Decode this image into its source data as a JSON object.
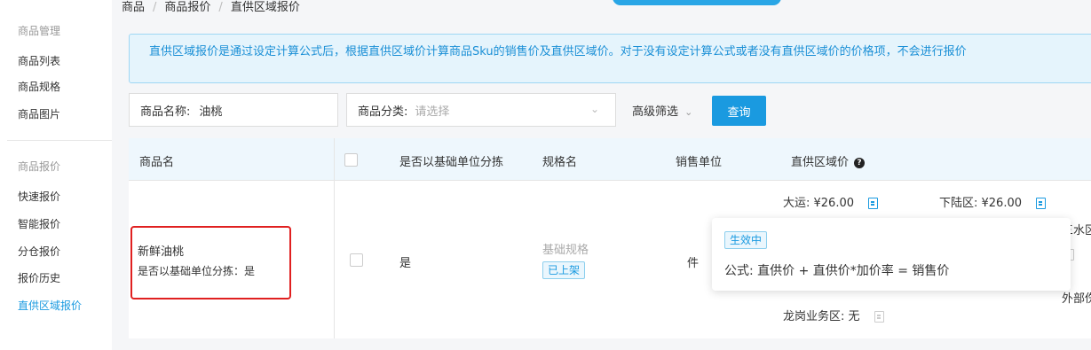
{
  "breadcrumb": [
    "商品",
    "商品报价",
    "直供区域报价"
  ],
  "sidebar": {
    "group1": "商品管理",
    "items1": [
      "商品列表",
      "商品规格",
      "商品图片"
    ],
    "group2": "商品报价",
    "items2": [
      "快速报价",
      "智能报价",
      "分仓报价",
      "报价历史",
      "直供区域报价"
    ]
  },
  "info_bar": "直供区域报价是通过设定计算公式后，根据直供区域价计算商品Sku的销售价及直供区域价。对于没有设定计算公式或者没有直供区域价的价格项，不会进行报价",
  "filters": {
    "name_label": "商品名称:",
    "name_value": "油桃",
    "category_label": "商品分类:",
    "category_placeholder": "请选择",
    "advanced": "高级筛选",
    "query": "查询"
  },
  "table": {
    "headers": [
      "商品名",
      "是否以基础单位分拣",
      "规格名",
      "销售单位",
      "直供区域价"
    ],
    "row": {
      "name": "新鲜油桃",
      "sub": "是否以基础单位分拣：是",
      "basic_sort": "是",
      "spec": "基础规格",
      "status": "已上架",
      "unit": "件",
      "prices": {
        "dayun": "大运: ¥26.00",
        "xialu": "下陆区: ¥26.00",
        "sanshui": "三水区",
        "waibu": "外部伤",
        "longgang": "龙岗业务区: 无"
      }
    }
  },
  "popover": {
    "tag": "生效中",
    "formula": "公式:  直供价 + 直供价*加价率 = 销售价"
  }
}
